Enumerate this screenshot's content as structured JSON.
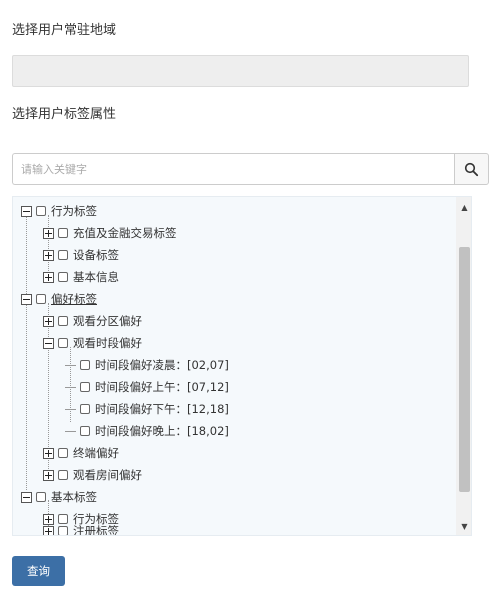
{
  "labels": {
    "region": "选择用户常驻地域",
    "attributes": "选择用户标签属性"
  },
  "region_select": {
    "value": ""
  },
  "search": {
    "placeholder": "请输入关键字",
    "icon": "search-icon"
  },
  "tree": {
    "n0": "行为标签",
    "n0_0": "充值及金融交易标签",
    "n0_1": "设备标签",
    "n0_2": "基本信息",
    "n1": "偏好标签",
    "n1_0": "观看分区偏好",
    "n1_1": "观看时段偏好",
    "n1_1_0": "时间段偏好凌晨：[02,07]",
    "n1_1_1": "时间段偏好上午：[07,12]",
    "n1_1_2": "时间段偏好下午：[12,18]",
    "n1_1_3": "时间段偏好晚上：[18,02]",
    "n1_2": "终端偏好",
    "n1_3": "观看房间偏好",
    "n2": "基本标签",
    "n2_0": "行为标签",
    "n2_1": "注册标签"
  },
  "actions": {
    "query": "查询"
  },
  "colors": {
    "primary_button": "#3c6fa6",
    "tree_background": "#f5f9fc"
  }
}
